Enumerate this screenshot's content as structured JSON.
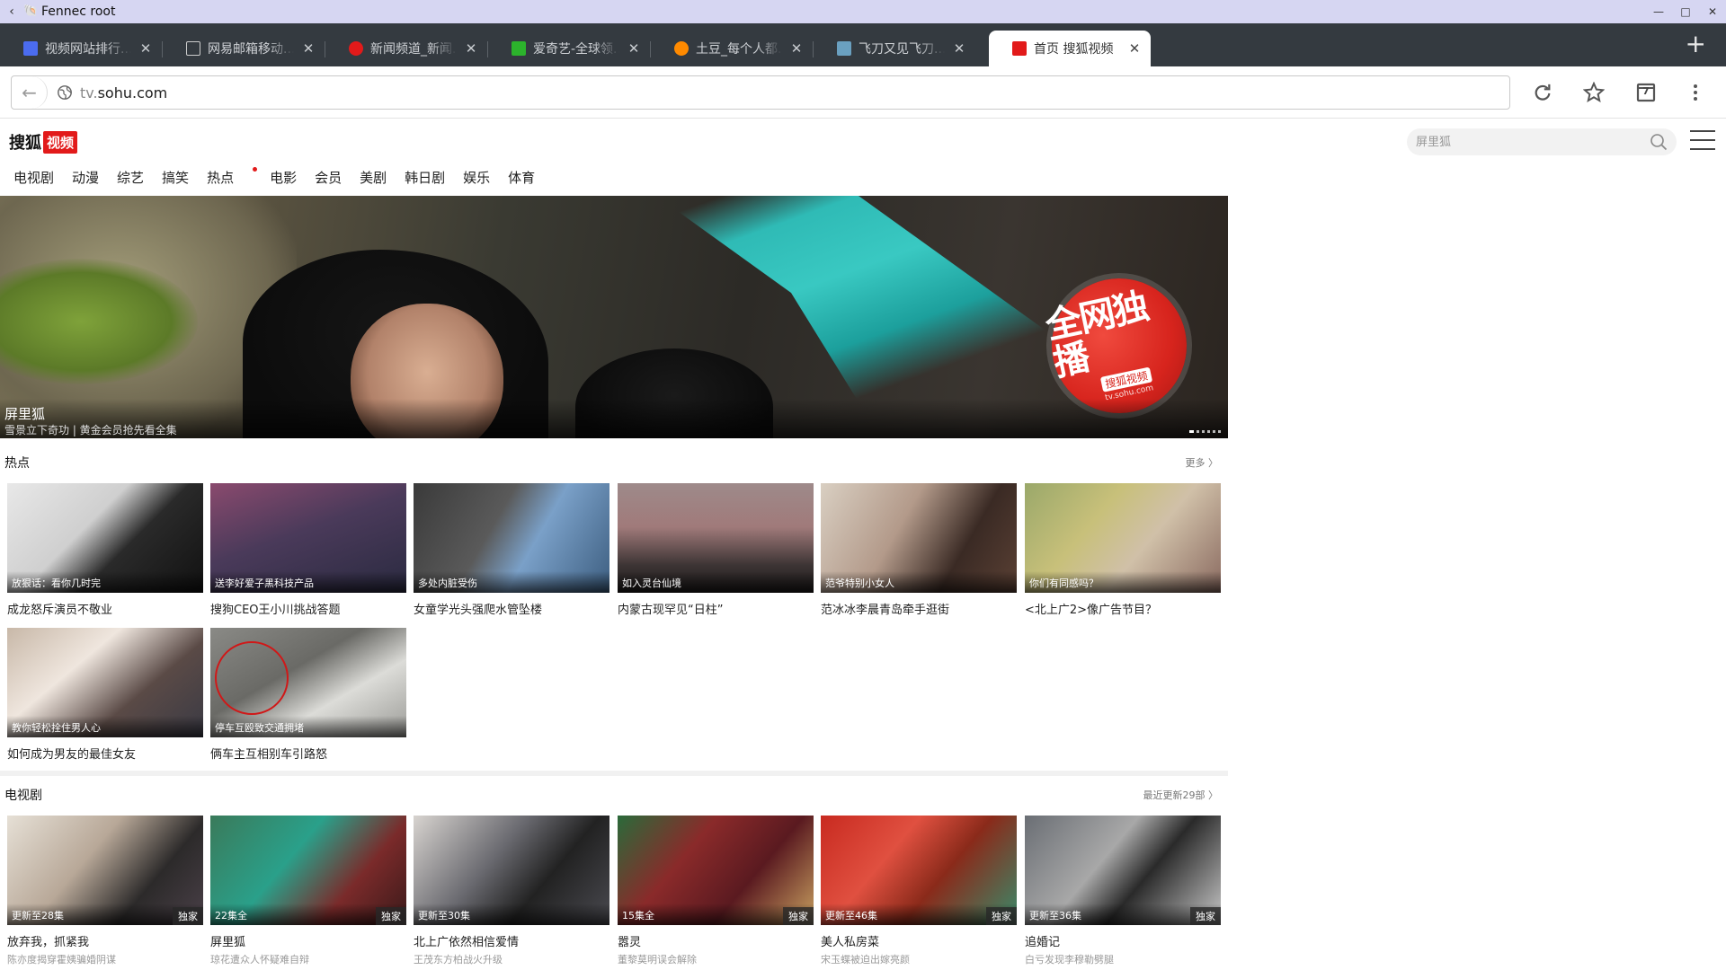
{
  "window": {
    "title": "Fennec root"
  },
  "tabs": [
    {
      "label": "视频网站排行...",
      "color": "#4b6cf0"
    },
    {
      "label": "网易邮箱移动...",
      "color": "#ffffff"
    },
    {
      "label": "新闻频道_新闻...",
      "color": "#e21a1a"
    },
    {
      "label": "爱奇艺-全球领...",
      "color": "#2cb32c"
    },
    {
      "label": "土豆_每个人都...",
      "color": "#ff8a00"
    },
    {
      "label": "飞刀又见飞刀...",
      "color": "#6aa0c0"
    },
    {
      "label": "首页 搜狐视频",
      "color": "#e21a1a",
      "active": true
    }
  ],
  "toolbar": {
    "url_dim": "tv.",
    "url_main": "sohu.com",
    "tab_count": "7"
  },
  "site": {
    "logo_text": "搜狐",
    "logo_badge": "视频",
    "search_placeholder": "屏里狐",
    "nav": [
      "电视剧",
      "动漫",
      "综艺",
      "搞笑",
      "热点",
      "电影",
      "会员",
      "美剧",
      "韩日剧",
      "娱乐",
      "体育"
    ]
  },
  "hero": {
    "title": "屏里狐",
    "subtitle": "雪景立下奇功 | 黄金会员抢先看全集",
    "stamp_main": "全网独播",
    "stamp_badge": "搜狐视频",
    "stamp_url": "tv.sohu.com"
  },
  "hot": {
    "title": "热点",
    "more": "更多 〉",
    "items": [
      {
        "overlay": "放狠话：看你几时完",
        "title": "成龙怒斥演员不敬业",
        "bg": "linear-gradient(135deg,#e8e8e8 0%,#cfcfcf 40%,#2a2a2a 60%,#111 100%)"
      },
      {
        "overlay": "送李好爱子黑科技产品",
        "title": "搜狗CEO王小川挑战答题",
        "bg": "linear-gradient(160deg,#8a4a6e 0%,#4a3a5a 45%,#2a2a40 100%)"
      },
      {
        "overlay": "多处内脏受伤",
        "title": "女童学光头强爬水管坠楼",
        "bg": "linear-gradient(120deg,#3a3a3a 0%,#5a5a5a 40%,#7aa0c8 60%,#3d5e80 100%)"
      },
      {
        "overlay": "如入灵台仙境",
        "title": "内蒙古现罕见“日柱”",
        "bg": "linear-gradient(180deg,#9e8a8a 0%,#a07a7a 40%,#3c3434 75%,#1e1a1a 100%)"
      },
      {
        "overlay": "范爷特别小女人",
        "title": "范冰冰李晨青岛牵手逛街",
        "bg": "linear-gradient(120deg,#d9cfc2 0%,#b39a8a 40%,#3a2a24 70%,#5a4034 100%)"
      },
      {
        "overlay": "你们有同感吗？",
        "title": "<北上广2>像广告节目？",
        "bg": "linear-gradient(130deg,#9aa86a 0%,#c8c07a 35%,#d0c0a8 60%,#8a6a60 100%)"
      },
      {
        "overlay": "教你轻松拴住男人心",
        "title": "如何成为男友的最佳女友",
        "bg": "linear-gradient(140deg,#c8b8a8 0%,#efe6de 35%,#5a4a46 65%,#3a3a44 100%)"
      },
      {
        "overlay": "停车互殴致交通拥堵",
        "title": "俩车主互相别车引路怒",
        "bg": "linear-gradient(150deg,#8a8a86 0%,#6a6a66 40%,#dcdcd8 65%,#9a9a96 100%)"
      }
    ]
  },
  "tv": {
    "title": "电视剧",
    "more": "最近更新29部 〉",
    "items": [
      {
        "overlay": "更新至28集",
        "badge": "独家",
        "title": "放弃我，抓紧我",
        "sub": "陈亦度揭穿霍姨骗婚阴谋",
        "bg": "linear-gradient(130deg,#e6e0d6 0%,#b8a898 40%,#2c2a2a 70%,#4a4048 100%)"
      },
      {
        "overlay": "22集全",
        "badge": "独家",
        "title": "屏里狐",
        "sub": "琼花遭众人怀疑难自辩",
        "bg": "linear-gradient(130deg,#3a7a5a 0%,#2aa08a 40%,#7a2a2a 70%,#3a1a1a 100%)"
      },
      {
        "overlay": "更新至30集",
        "badge": "",
        "title": "北上广依然相信爱情",
        "sub": "王茂东方柏战火升级",
        "bg": "linear-gradient(130deg,#d8d4d0 0%,#6a6a70 40%,#222 65%,#4a4a50 100%)"
      },
      {
        "overlay": "15集全",
        "badge": "独家",
        "title": "嚣灵",
        "sub": "董黎莫明误会解除",
        "bg": "linear-gradient(130deg,#2a6a3a 0%,#8a2a2a 35%,#5a1a20 65%,#c8a060 100%)"
      },
      {
        "overlay": "更新至46集",
        "badge": "独家",
        "title": "美人私房菜",
        "sub": "宋玉蝶被迫出嫁亮颜",
        "bg": "linear-gradient(130deg,#c82a20 0%,#e05040 35%,#8a2a1a 60%,#3a8a6a 100%)"
      },
      {
        "overlay": "更新至36集",
        "badge": "独家",
        "title": "追婚记",
        "sub": "白亏发现李穆勒劈腿",
        "bg": "linear-gradient(130deg,#6a6e74 0%,#a8a8a8 40%,#2a2a2a 60%,#c8c8c8 100%)"
      }
    ]
  }
}
